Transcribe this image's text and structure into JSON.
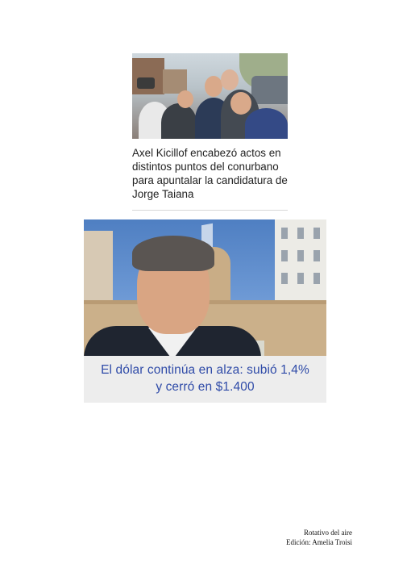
{
  "story1": {
    "headline_lines": [
      "Axel Kicillof encabezó actos en",
      "distintos puntos del conurbano",
      "para apuntalar la candidatura de",
      "Jorge Taiana"
    ]
  },
  "story2": {
    "headline_lines": [
      "El dólar continúa en alza: subió 1,4%",
      "y cerró en $1.400"
    ],
    "accent_color": "#2f4ba8"
  },
  "footer": {
    "line1": "Rotativo del aire",
    "line2": "Edición: Amelia Troisi"
  }
}
